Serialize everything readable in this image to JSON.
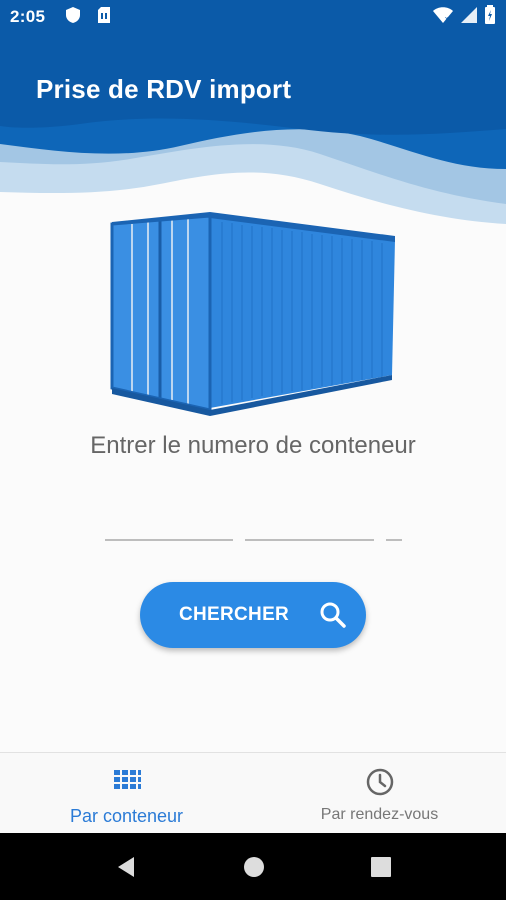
{
  "status_bar": {
    "time": "2:05",
    "icons": [
      "shield-icon",
      "sim-card-icon",
      "wifi-icon",
      "signal-icon",
      "battery-icon"
    ]
  },
  "header": {
    "title": "Prise de RDV import",
    "colors": {
      "primary": "#0b5aa8",
      "wave_light": "#c5dcef",
      "wave_mid": "#a3c6e4"
    }
  },
  "main": {
    "image": "shipping-container-image",
    "prompt": "Entrer le numero de conteneur",
    "container_number_fields": [
      "",
      "",
      ""
    ],
    "search_button": {
      "label": "CHERCHER",
      "icon": "search-icon",
      "color": "#2b8ae5"
    }
  },
  "bottom_nav": {
    "items": [
      {
        "label": "Par conteneur",
        "icon": "grid-icon",
        "active": true
      },
      {
        "label": "Par rendez-vous",
        "icon": "clock-icon",
        "active": false
      }
    ],
    "active_color": "#2b7bd6"
  },
  "system_nav": [
    "back-button",
    "home-button",
    "recents-button"
  ]
}
